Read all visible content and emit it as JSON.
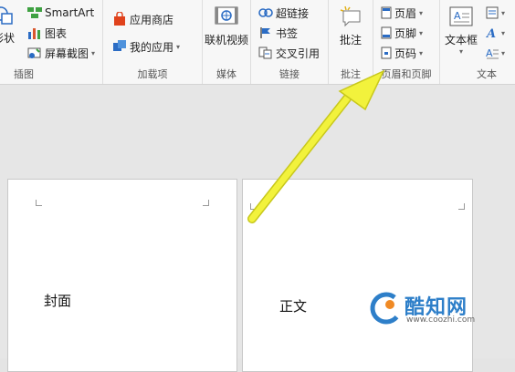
{
  "ribbon": {
    "illustrations": {
      "shapes_label": "形状",
      "smartart_label": "SmartArt",
      "chart_label": "图表",
      "screenshot_label": "屏幕截图",
      "group_label": "插图"
    },
    "addins": {
      "store_label": "应用商店",
      "myapps_label": "我的应用",
      "group_label": "加载项"
    },
    "media": {
      "online_video_label": "联机视频",
      "group_label": "媒体"
    },
    "links": {
      "hyperlink_label": "超链接",
      "bookmark_label": "书签",
      "crossref_label": "交叉引用",
      "group_label": "链接"
    },
    "comments": {
      "comment_label": "批注",
      "group_label": "批注"
    },
    "header_footer": {
      "header_label": "页眉",
      "footer_label": "页脚",
      "page_number_label": "页码",
      "group_label": "页眉和页脚"
    },
    "text": {
      "textbox_label": "文本框",
      "group_label": "文本"
    }
  },
  "document": {
    "page1_text": "封面",
    "page2_text": "正文"
  },
  "watermark": {
    "brand": "酷知网",
    "url": "www.coozhi.com"
  },
  "colors": {
    "arrow": "#f2f23c",
    "watermark_blue": "#2e7fc9",
    "watermark_orange": "#f08a24"
  }
}
